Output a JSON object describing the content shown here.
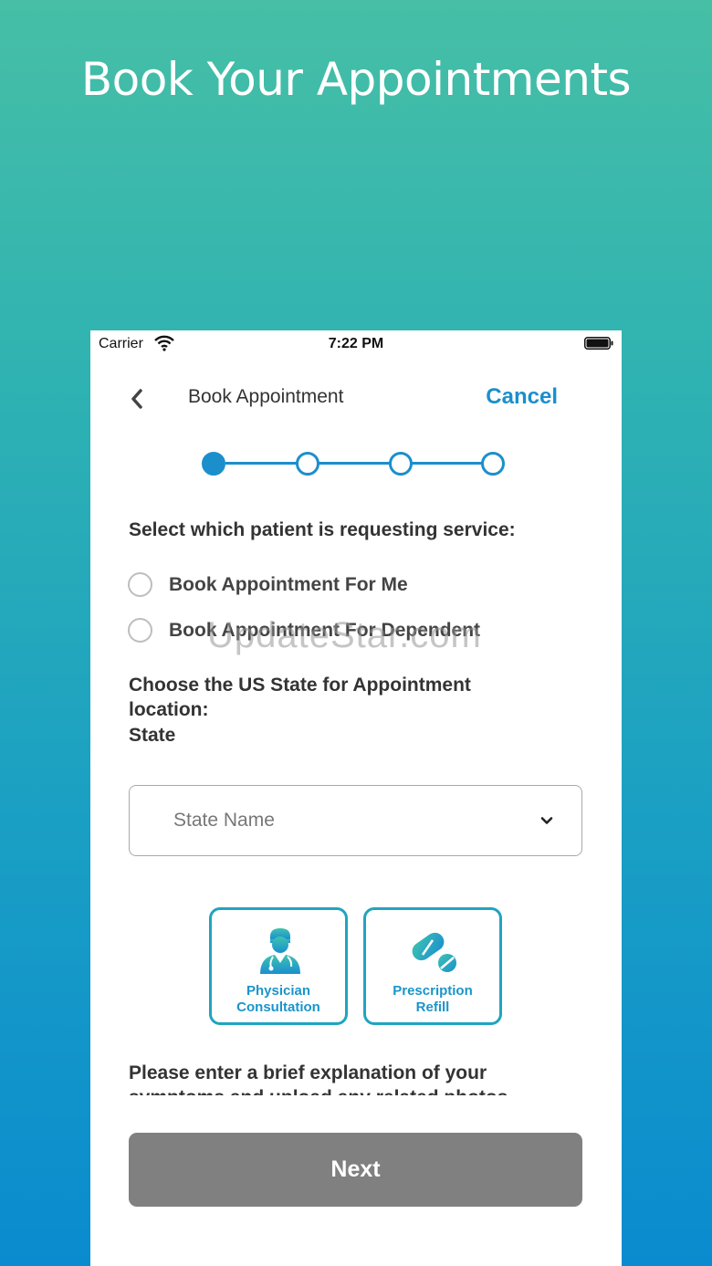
{
  "headline": "Book Your Appointments",
  "status_bar": {
    "carrier": "Carrier",
    "time": "7:22 PM"
  },
  "nav": {
    "title": "Book Appointment",
    "cancel_label": "Cancel"
  },
  "stepper": {
    "total_steps": 4,
    "current_step": 1
  },
  "patient_question": "Select which patient is requesting service:",
  "patient_options": [
    {
      "label": "Book Appointment For Me",
      "selected": false
    },
    {
      "label": "Book Appointment For Dependent",
      "selected": false
    }
  ],
  "watermark": "UpdateStar.com",
  "state_question": "Choose the US State for Appointment location:",
  "state_label": "State",
  "state_select": {
    "placeholder": "State Name"
  },
  "service_cards": [
    {
      "line1": "Physician",
      "line2": "Consultation",
      "icon": "doctor-icon"
    },
    {
      "line1": "Prescription",
      "line2": "Refill",
      "icon": "pill-icon"
    }
  ],
  "symptoms_prompt": "Please enter a brief explanation of your symptoms and upload any related photos",
  "next_label": "Next",
  "colors": {
    "accent": "#1b8fcc",
    "card_border": "#20a4bf",
    "button_disabled": "#808080"
  }
}
